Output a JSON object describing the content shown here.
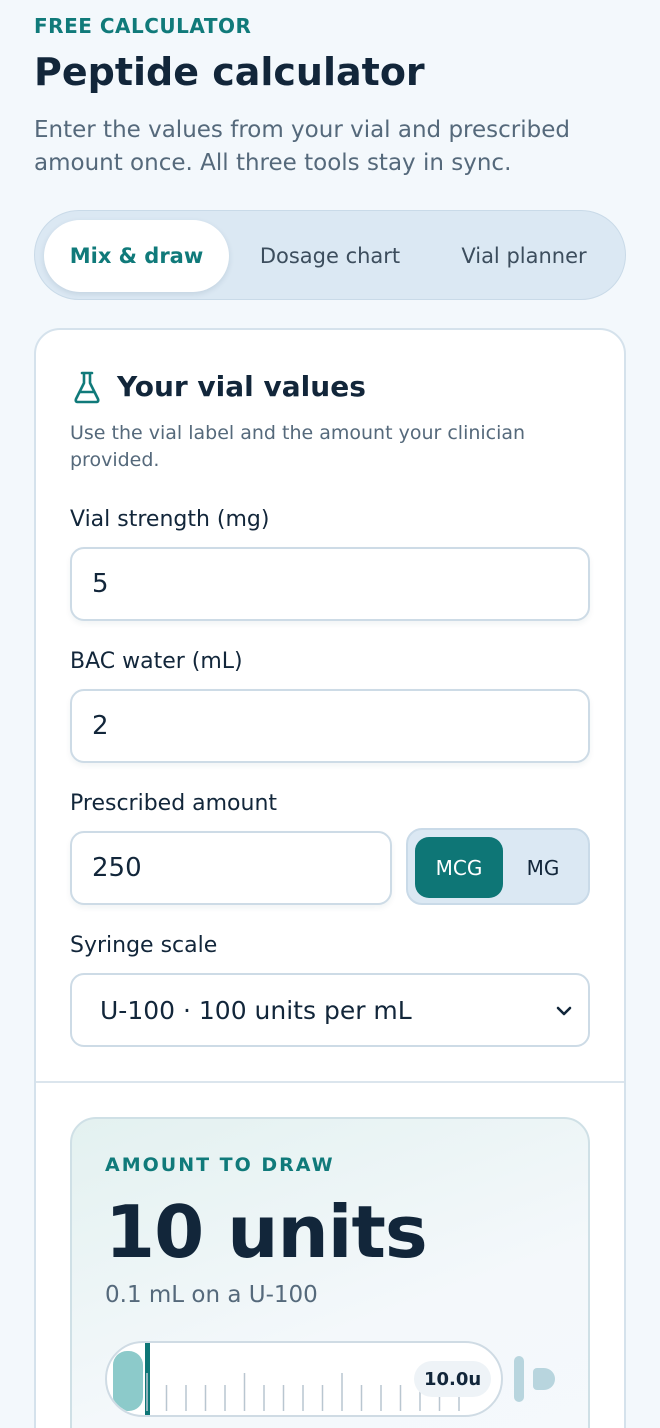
{
  "header": {
    "eyebrow": "FREE CALCULATOR",
    "title": "Peptide calculator",
    "subtitle": "Enter the values from your vial and prescribed amount once. All three tools stay in sync."
  },
  "tabs": [
    {
      "label": "Mix & draw",
      "active": true
    },
    {
      "label": "Dosage chart",
      "active": false
    },
    {
      "label": "Vial planner",
      "active": false
    }
  ],
  "vial_card": {
    "icon": "flask-icon",
    "title": "Your vial values",
    "description": "Use the vial label and the amount your clinician provided.",
    "vial_strength": {
      "label": "Vial strength (mg)",
      "value": "5"
    },
    "bac_water": {
      "label": "BAC water (mL)",
      "value": "2"
    },
    "prescribed": {
      "label": "Prescribed amount",
      "value": "250"
    },
    "unit_toggle": {
      "options": [
        "MCG",
        "MG"
      ],
      "selected": "MCG"
    },
    "syringe_scale": {
      "label": "Syringe scale",
      "selected": "U-100 · 100 units per mL"
    }
  },
  "result": {
    "eyebrow": "AMOUNT TO DRAW",
    "amount": "10 units",
    "detail": "0.1 mL on a U-100",
    "syringe_tag": "10.0u",
    "syringe_fill_fraction": 0.1
  },
  "colors": {
    "accent": "#0e7676",
    "text": "#12263a",
    "muted": "#55697b",
    "background": "#f3f8fc"
  }
}
